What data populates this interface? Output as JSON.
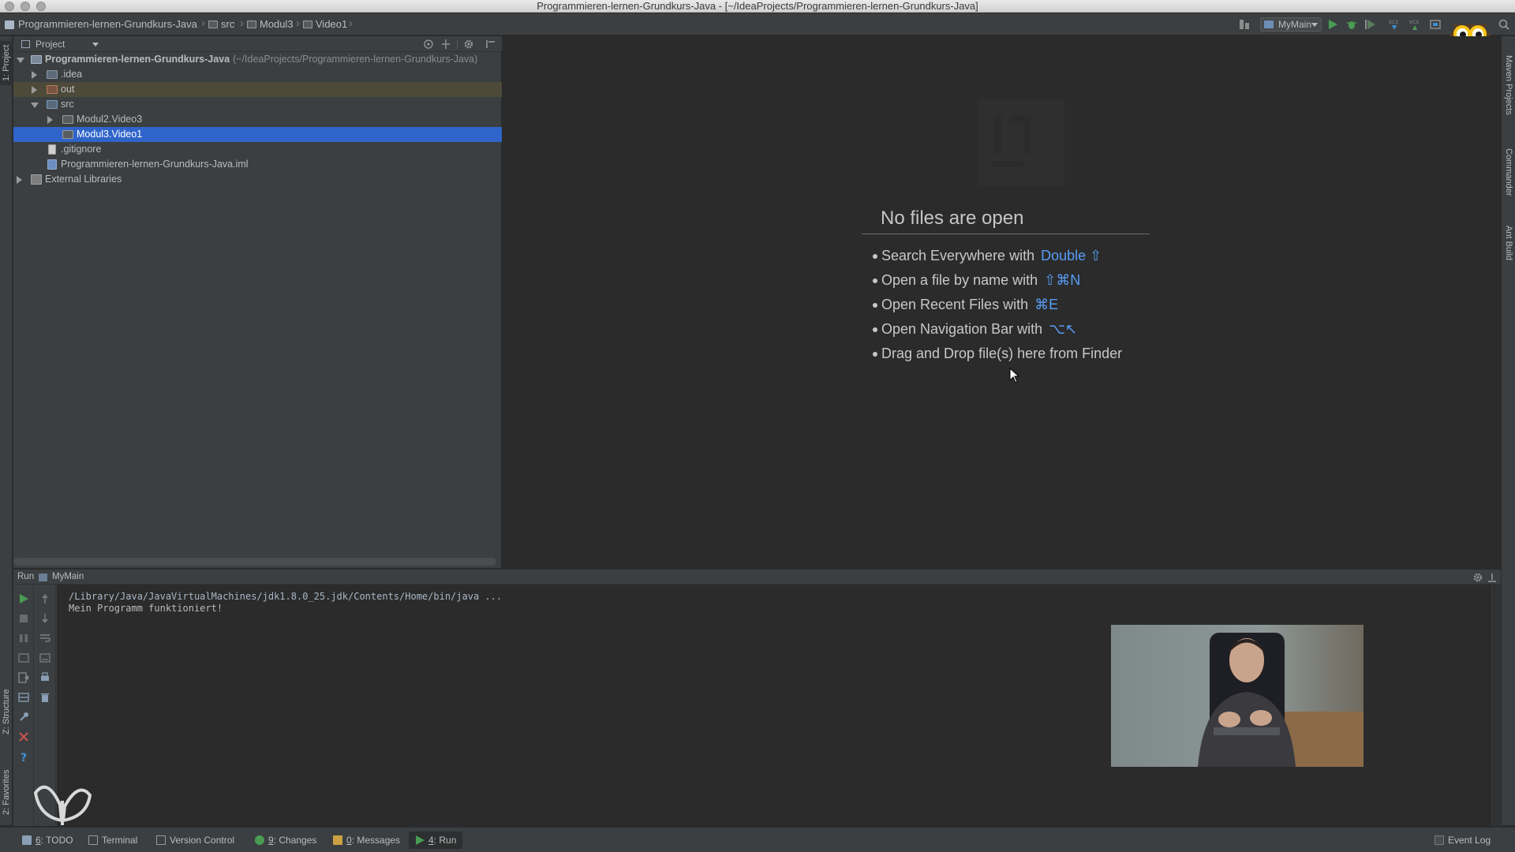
{
  "window": {
    "title": "Programmieren-lernen-Grundkurs-Java - [~/IdeaProjects/Programmieren-lernen-Grundkurs-Java]"
  },
  "navbar": {
    "crumbs": [
      "Programmieren-lernen-Grundkurs-Java",
      "src",
      "Modul3",
      "Video1"
    ],
    "run_config": "MyMain"
  },
  "left_stripe": {
    "project_tab": "1: Project",
    "structure_tab": "Z: Structure",
    "favorites_tab": "2: Favorites"
  },
  "right_stripe": {
    "tabs": [
      "Maven Projects",
      "Commander",
      "Ant Build"
    ]
  },
  "project_panel": {
    "header": "Project",
    "tree": [
      {
        "label": "Programmieren-lernen-Grundkurs-Java",
        "path": "(~/IdeaProjects/Programmieren-lernen-Grundkurs-Java)"
      },
      {
        "label": ".idea"
      },
      {
        "label": "out"
      },
      {
        "label": "src"
      },
      {
        "label": "Modul2.Video3"
      },
      {
        "label": "Modul3.Video1"
      },
      {
        "label": ".gitignore"
      },
      {
        "label": "Programmieren-lernen-Grundkurs-Java.iml"
      },
      {
        "label": "External Libraries"
      }
    ]
  },
  "editor": {
    "empty_title": "No files are open",
    "hints": [
      {
        "text": "Search Everywhere with",
        "key": "Double ⇧"
      },
      {
        "text": "Open a file by name with",
        "key": "⇧⌘N"
      },
      {
        "text": "Open Recent Files with",
        "key": "⌘E"
      },
      {
        "text": "Open Navigation Bar with",
        "key": "⌥↖"
      },
      {
        "text": "Drag and Drop file(s) here from Finder",
        "key": ""
      }
    ]
  },
  "run_window": {
    "title": "Run",
    "tab": "MyMain",
    "console": [
      "/Library/Java/JavaVirtualMachines/jdk1.8.0_25.jdk/Contents/Home/bin/java ...",
      "Mein Programm funktioniert!"
    ]
  },
  "statusbar": {
    "todo": {
      "num": "6",
      "label": ": TODO"
    },
    "terminal": "Terminal",
    "vcs": "Version Control",
    "changes": {
      "num": "9",
      "label": ": Changes"
    },
    "messages": {
      "num": "0",
      "label": ": Messages"
    },
    "run": {
      "num": "4",
      "label": ": Run"
    },
    "event_log": "Event Log"
  },
  "colors": {
    "selection": "#2f65ca",
    "link_key": "#589df6",
    "run_green": "#499c54",
    "out_folder": "#b87c5a"
  }
}
